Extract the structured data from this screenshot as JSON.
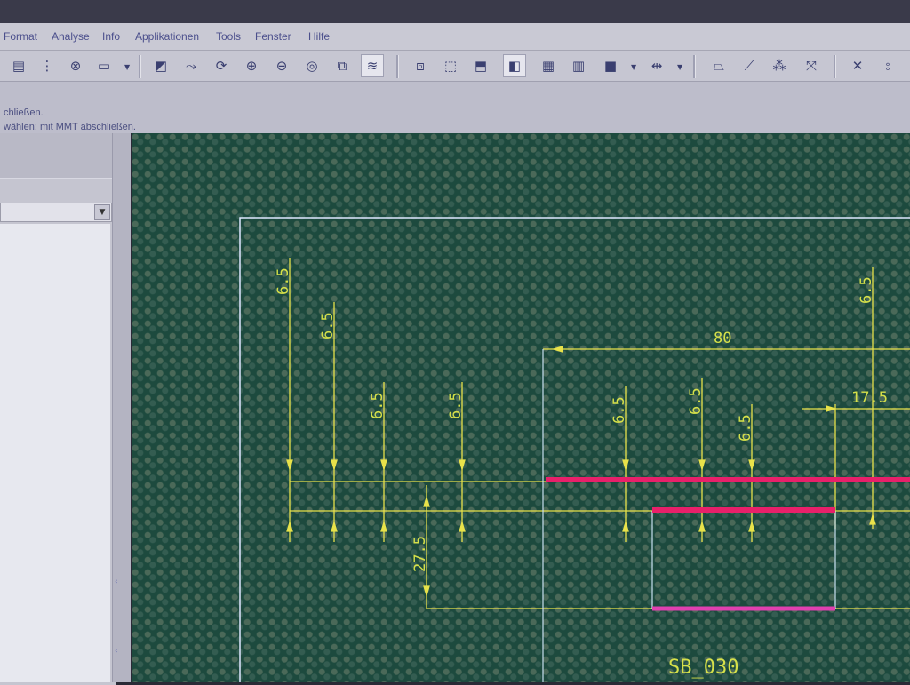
{
  "menubar": {
    "items": [
      "Format",
      "Analyse",
      "Info",
      "Applikationen",
      "Tools",
      "Fenster",
      "Hilfe"
    ]
  },
  "toolbar": {
    "icons": [
      "clipboard-icon",
      "tree-icon",
      "binoculars-icon",
      "select-box-icon",
      "repaint-icon",
      "spin-icon",
      "orient-icon",
      "zoom-in-icon",
      "zoom-out-icon",
      "refit-icon",
      "view-manager-icon",
      "layers-icon",
      "wireframe-icon",
      "hidden-line-icon",
      "no-hidden-icon",
      "shading-icon",
      "color-icon",
      "split-view-icon",
      "display-icon",
      "spin-center-icon",
      "datum-plane-icon",
      "datum-axis-icon",
      "datum-point-icon",
      "coordinate-system-icon",
      "close-icon",
      "info-icon"
    ]
  },
  "status": {
    "line1": "chließen.",
    "line2": "wählen; mit MMT abschließen."
  },
  "drawing": {
    "dimensions": [
      "6.5",
      "6.5",
      "6.5",
      "6.5",
      "6.5",
      "6.5",
      "6.5",
      "6.5",
      "80",
      "17.5",
      "27.5"
    ],
    "label": "SB_030",
    "colors": {
      "dimension": "#e8e24a",
      "frame": "#dfe7ff",
      "edge_red": "#e8206a",
      "edge_magenta": "#e040b0",
      "text": "#d6e04a"
    }
  }
}
